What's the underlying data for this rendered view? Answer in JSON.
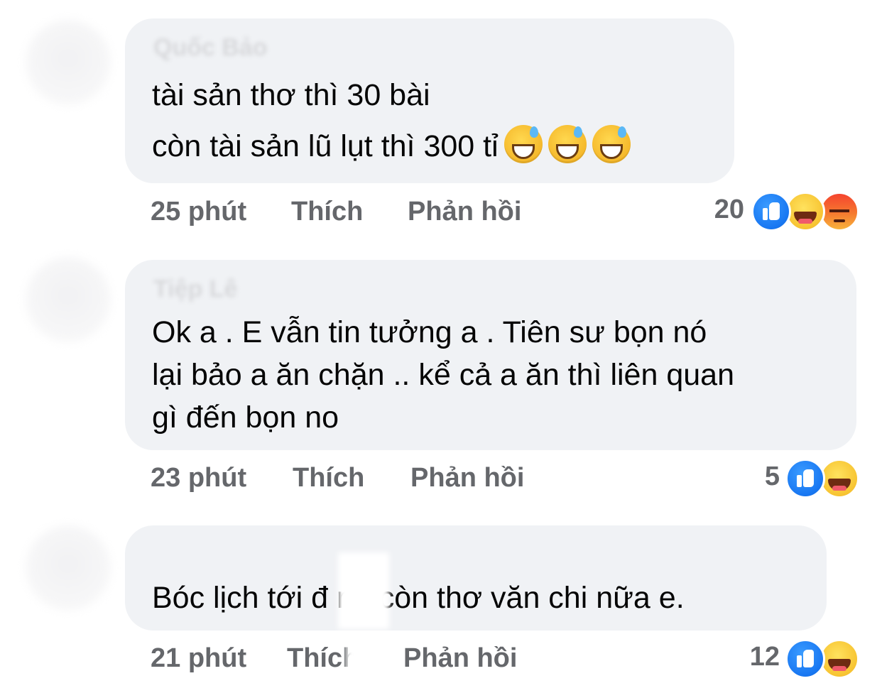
{
  "comments": [
    {
      "author": "Quốc Bảo",
      "lines": [
        "tài sản thơ thì 30 bài",
        "còn tài sản lũ lụt thì 300 tỉ"
      ],
      "trailing_emoji": [
        "grinning-sweat-emoji",
        "grinning-sweat-emoji",
        "grinning-sweat-emoji"
      ],
      "time": "25 phút",
      "like_label": "Thích",
      "reply_label": "Phản hồi",
      "reaction_count": "20",
      "reactions": [
        "like",
        "haha",
        "angry"
      ]
    },
    {
      "author": "Tiệp Lê",
      "lines": [
        "Ok a . E vẫn tin tưởng a . Tiên sư bọn nó",
        "lại bảo a ăn chặn .. kể cả a ăn thì liên quan",
        "gì đến bọn no"
      ],
      "time": "23 phút",
      "like_label": "Thích",
      "reply_label": "Phản hồi",
      "reaction_count": "5",
      "reactions": [
        "like",
        "haha"
      ]
    },
    {
      "author": "",
      "lines": [
        "Bóc lịch tới đ   rồi còn thơ văn chi nữa e."
      ],
      "time": "21 phút",
      "like_label": "Thích",
      "reply_label": "Phản hồi",
      "reaction_count": "12",
      "reactions": [
        "like",
        "haha"
      ]
    }
  ],
  "colors": {
    "bubble": "#f0f2f5",
    "text": "#050505",
    "meta": "#65676b",
    "like": "#1877f2",
    "haha": "#f7c432",
    "angry": "#f5442f"
  }
}
